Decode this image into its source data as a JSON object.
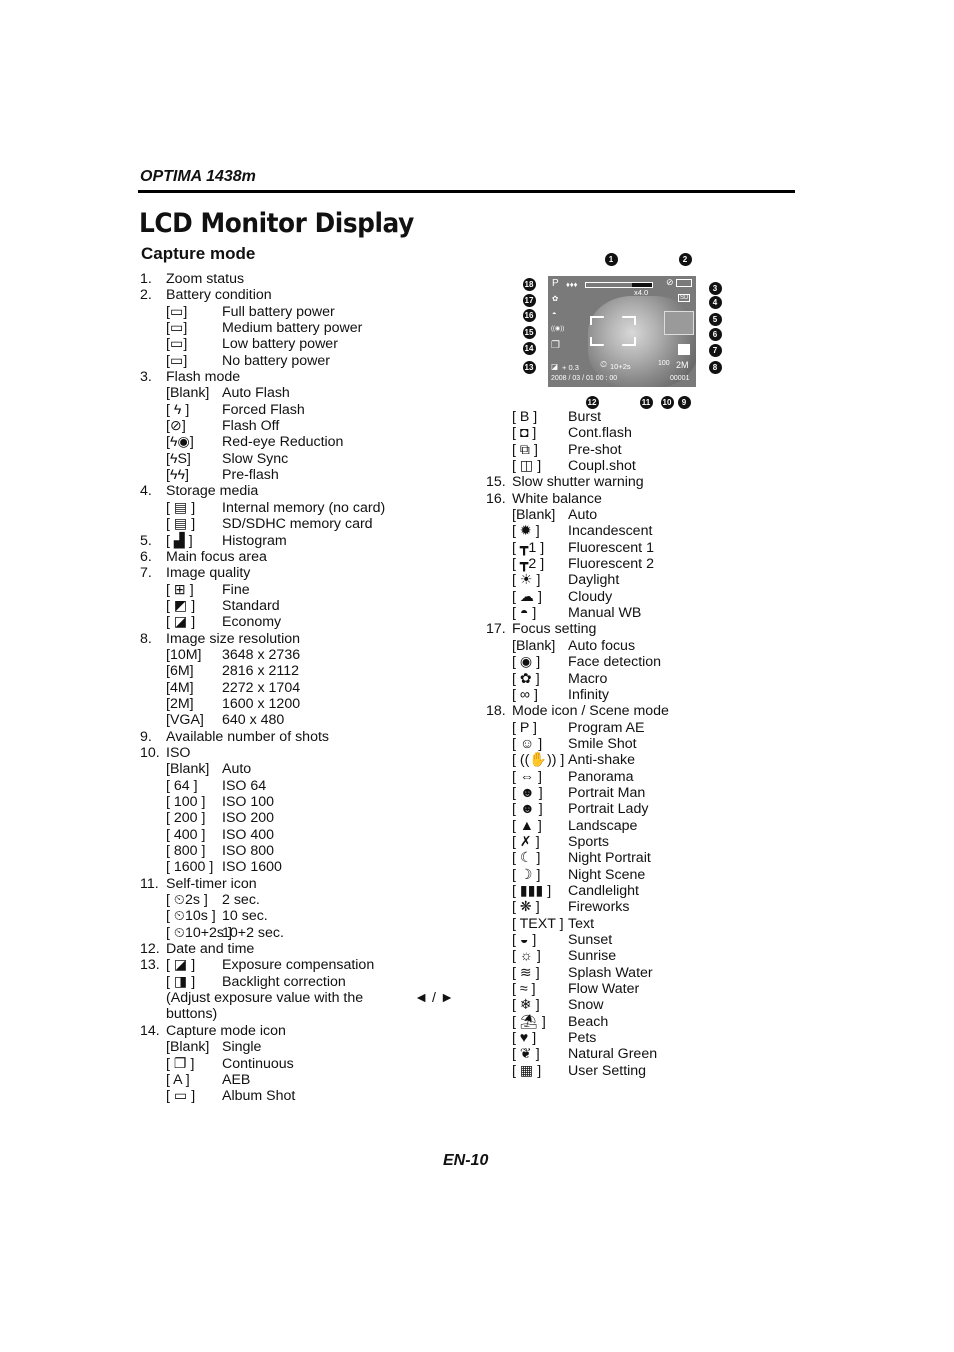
{
  "header": {
    "brand": "OPTIMA 1438m",
    "title": "LCD Monitor Display",
    "subtitle": "Capture mode"
  },
  "left_list": [
    {
      "num": "1.",
      "label": "Zoom status"
    },
    {
      "num": "2.",
      "label": "Battery condition"
    },
    {
      "icon": "[▭]",
      "icon_name": "battery-full-icon",
      "label": "Full battery power"
    },
    {
      "icon": "[▭]",
      "icon_name": "battery-medium-icon",
      "label": "Medium battery power"
    },
    {
      "icon": "[▭]",
      "icon_name": "battery-low-icon",
      "label": "Low battery power"
    },
    {
      "icon": "[▭]",
      "icon_name": "battery-empty-icon",
      "label": "No battery power"
    },
    {
      "num": "3.",
      "label": "Flash  mode"
    },
    {
      "icon": "[Blank]",
      "icon_name": "blank",
      "label": "Auto Flash"
    },
    {
      "icon": "[ ϟ ]",
      "icon_name": "forced-flash-icon",
      "label": "Forced Flash"
    },
    {
      "icon": "[⊘]",
      "icon_name": "flash-off-icon",
      "label": "Flash Off"
    },
    {
      "icon": "[ϟ◉]",
      "icon_name": "red-eye-icon",
      "label": "Red-eye Reduction"
    },
    {
      "icon": "[ϟS]",
      "icon_name": "slow-sync-icon",
      "label": "Slow Sync"
    },
    {
      "icon": "[ϟϟ]",
      "icon_name": "pre-flash-icon",
      "label": "Pre-flash"
    },
    {
      "num": "4.",
      "label": "Storage media"
    },
    {
      "icon": "[ ▤ ]",
      "icon_name": "internal-memory-icon",
      "label": "Internal memory (no card)"
    },
    {
      "icon": "[ ▤ ]",
      "icon_name": "sd-card-icon",
      "label": "SD/SDHC memory card"
    },
    {
      "num": "5.",
      "icon": "[ ▟ ]",
      "icon_name": "histogram-icon",
      "label": "Histogram"
    },
    {
      "num": "6.",
      "label": "Main focus area"
    },
    {
      "num": "7.",
      "label": "Image quality"
    },
    {
      "icon": "[ ⊞ ]",
      "icon_name": "quality-fine-icon",
      "label": "Fine"
    },
    {
      "icon": "[ ◩ ]",
      "icon_name": "quality-standard-icon",
      "label": "Standard"
    },
    {
      "icon": "[ ◪ ]",
      "icon_name": "quality-economy-icon",
      "label": "Economy"
    },
    {
      "num": "8.",
      "label": "Image size resolution"
    },
    {
      "icon": "[10M]",
      "icon_name": "size-10m-icon",
      "label": "3648 x 2736"
    },
    {
      "icon": "[6M]",
      "icon_name": "size-6m-icon",
      "label": "2816 x 2112"
    },
    {
      "icon": "[4M]",
      "icon_name": "size-4m-icon",
      "label": "2272 x 1704"
    },
    {
      "icon": "[2M]",
      "icon_name": "size-2m-icon",
      "label": "1600 x 1200"
    },
    {
      "icon": "[VGA]",
      "icon_name": "size-vga-icon",
      "label": "640 x 480"
    },
    {
      "num": "9.",
      "label": "Available number of shots"
    },
    {
      "num": "10.",
      "label": "ISO"
    },
    {
      "icon": "[Blank]",
      "icon_name": "blank",
      "label": "Auto"
    },
    {
      "icon": "[ 64 ]",
      "icon_name": "iso-64-icon",
      "label": "ISO  64"
    },
    {
      "icon": "[ 100 ]",
      "icon_name": "iso-100-icon",
      "label": "ISO 100"
    },
    {
      "icon": "[ 200 ]",
      "icon_name": "iso-200-icon",
      "label": "ISO 200"
    },
    {
      "icon": "[ 400 ]",
      "icon_name": "iso-400-icon",
      "label": "ISO 400"
    },
    {
      "icon": "[ 800 ]",
      "icon_name": "iso-800-icon",
      "label": "ISO 800"
    },
    {
      "icon": "[ 1600 ]",
      "icon_name": "iso-1600-icon",
      "label": "ISO 1600"
    },
    {
      "num": "11.",
      "label": "Self-timer icon"
    },
    {
      "icon": "[ ⏲2s ]",
      "icon_name": "timer-2s-icon",
      "label": "2 sec."
    },
    {
      "icon": "[ ⏲10s ]",
      "icon_name": "timer-10s-icon",
      "label": "10 sec."
    },
    {
      "icon": "[ ⏲10+2s ]",
      "icon_name": "timer-10-2s-icon",
      "label": "10+2 sec."
    },
    {
      "num": "12.",
      "label": "Date and time"
    },
    {
      "num": "13.",
      "icon": "[ ◪ ]",
      "icon_name": "exposure-compensation-icon",
      "label": "Exposure compensation"
    },
    {
      "icon": "[ ◨ ]",
      "icon_name": "backlight-correction-icon",
      "label": "Backlight correction"
    },
    {
      "adjust": true,
      "label": "(Adjust  exposure  value  with  the",
      "arrows": "◄  /  ►"
    },
    {
      "plain": true,
      "label": "buttons)"
    },
    {
      "num": "14.",
      "label": "Capture mode icon"
    },
    {
      "icon": "[Blank]",
      "icon_name": "blank",
      "label": "Single"
    },
    {
      "icon": "[ ❐ ]",
      "icon_name": "continuous-icon",
      "label": "Continuous"
    },
    {
      "icon": "[ A ]",
      "icon_name": "aeb-icon",
      "label": "AEB"
    },
    {
      "icon": "[ ▭ ]",
      "icon_name": "album-shot-icon",
      "label": "Album Shot"
    }
  ],
  "right_list": [
    {
      "icon": "[ B ]",
      "icon_name": "burst-icon",
      "label": "Burst"
    },
    {
      "icon": "[ ◘ ]",
      "icon_name": "cont-flash-icon",
      "label": "Cont.flash"
    },
    {
      "icon": "[ ⧉ ]",
      "icon_name": "pre-shot-icon",
      "label": "Pre-shot"
    },
    {
      "icon": "[ ◫ ]",
      "icon_name": "coupl-shot-icon",
      "label": "Coupl.shot"
    },
    {
      "num": "15.",
      "label": "Slow shutter warning"
    },
    {
      "num": "16.",
      "label": "White balance"
    },
    {
      "icon": "[Blank]",
      "icon_name": "blank",
      "label": "Auto"
    },
    {
      "icon": "[ ✹ ]",
      "icon_name": "incandescent-icon",
      "label": "Incandescent"
    },
    {
      "icon": "[ ┳1 ]",
      "icon_name": "fluorescent-1-icon",
      "label": "Fluorescent 1"
    },
    {
      "icon": "[ ┳2 ]",
      "icon_name": "fluorescent-2-icon",
      "label": "Fluorescent 2"
    },
    {
      "icon": "[ ☀ ]",
      "icon_name": "daylight-icon",
      "label": "Daylight"
    },
    {
      "icon": "[ ☁ ]",
      "icon_name": "cloudy-icon",
      "label": "Cloudy"
    },
    {
      "icon": "[ ◓ ]",
      "icon_name": "manual-wb-icon",
      "label": "Manual WB"
    },
    {
      "num": "17.",
      "label": "Focus setting"
    },
    {
      "icon": "[Blank]",
      "icon_name": "blank",
      "label": "Auto focus"
    },
    {
      "icon": "[ ◉ ]",
      "icon_name": "face-detection-icon",
      "label": "Face detection"
    },
    {
      "icon": "[ ✿ ]",
      "icon_name": "macro-icon",
      "label": "Macro"
    },
    {
      "icon": "[ ∞ ]",
      "icon_name": "infinity-icon",
      "label": "Infinity"
    },
    {
      "num": "18.",
      "label": "Mode icon / Scene  mode"
    },
    {
      "icon": "[ P ]",
      "icon_name": "program-ae-icon",
      "label": "Program AE"
    },
    {
      "icon": "[ ☺ ]",
      "icon_name": "smile-shot-icon",
      "label": "Smile Shot"
    },
    {
      "icon": "[ ((✋)) ]",
      "icon_name": "anti-shake-icon",
      "label": "Anti-shake"
    },
    {
      "icon": "[ ⇔ ]",
      "icon_name": "panorama-icon",
      "label": "Panorama"
    },
    {
      "icon": "[ ☻ ]",
      "icon_name": "portrait-man-icon",
      "label": "Portrait Man"
    },
    {
      "icon": "[ ☻ ]",
      "icon_name": "portrait-lady-icon",
      "label": "Portrait Lady"
    },
    {
      "icon": "[ ▲ ]",
      "icon_name": "landscape-icon",
      "label": "Landscape"
    },
    {
      "icon": "[ ✗ ]",
      "icon_name": "sports-icon",
      "label": "Sports"
    },
    {
      "icon": "[ ☾ ]",
      "icon_name": "night-portrait-icon",
      "label": "Night Portrait"
    },
    {
      "icon": "[ ☽ ]",
      "icon_name": "night-scene-icon",
      "label": "Night Scene"
    },
    {
      "icon": "[ ▮▮▮ ]",
      "icon_name": "candlelight-icon",
      "label": "Candlelight"
    },
    {
      "icon": "[ ❋ ]",
      "icon_name": "fireworks-icon",
      "label": "Fireworks"
    },
    {
      "icon": "[ TEXT ]",
      "icon_name": "text-mode-icon",
      "label": "Text"
    },
    {
      "icon": "[ ◒ ]",
      "icon_name": "sunset-icon",
      "label": "Sunset"
    },
    {
      "icon": "[ ☼ ]",
      "icon_name": "sunrise-icon",
      "label": "Sunrise"
    },
    {
      "icon": "[ ≋ ]",
      "icon_name": "splash-water-icon",
      "label": "Splash Water"
    },
    {
      "icon": "[ ≈ ]",
      "icon_name": "flow-water-icon",
      "label": "Flow Water"
    },
    {
      "icon": "[ ❄ ]",
      "icon_name": "snow-icon",
      "label": "Snow"
    },
    {
      "icon": "[ ⛱ ]",
      "icon_name": "beach-icon",
      "label": "Beach"
    },
    {
      "icon": "[ ♥ ]",
      "icon_name": "pets-icon",
      "label": "Pets"
    },
    {
      "icon": "[ ❦ ]",
      "icon_name": "natural-green-icon",
      "label": "Natural Green"
    },
    {
      "icon": "[ ▦ ]",
      "icon_name": "user-setting-icon",
      "label": "User Setting"
    }
  ],
  "lcd": {
    "mode": "P",
    "zoom_readout": "x4.0",
    "exposure": "+ 0.3",
    "timer": "10+2s",
    "date_time": "2008 / 03 / 01   00 : 00",
    "iso": "100",
    "size": "2M",
    "shots": "00001",
    "storage": "SD",
    "callouts": [
      "1",
      "2",
      "3",
      "4",
      "5",
      "6",
      "7",
      "8",
      "9",
      "10",
      "11",
      "12",
      "13",
      "14",
      "15",
      "16",
      "17",
      "18"
    ]
  },
  "footer": {
    "page": "EN-10"
  }
}
